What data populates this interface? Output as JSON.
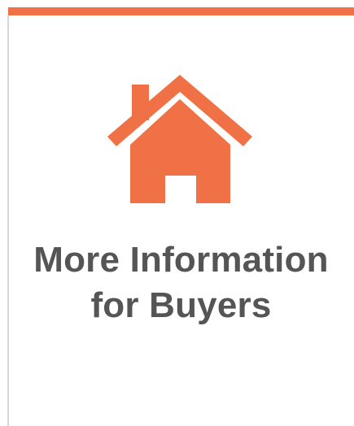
{
  "card": {
    "accent_color": "#f07145",
    "icon": "house-icon",
    "title_line1": "More Information",
    "title_line2": "for Buyers",
    "title_color": "#555555"
  }
}
